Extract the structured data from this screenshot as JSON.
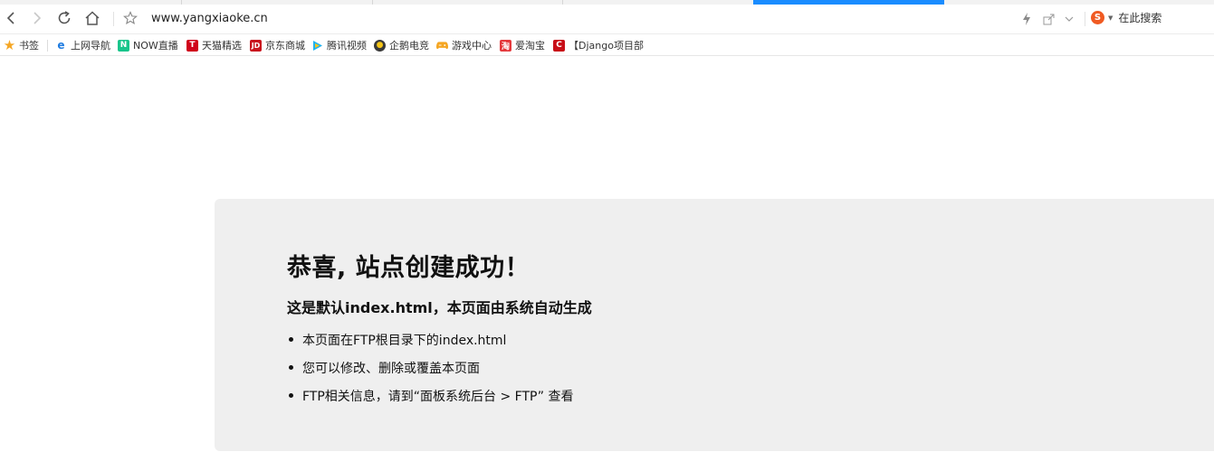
{
  "browser": {
    "url": "www.yangxiaoke.cn",
    "search_placeholder": "在此搜索"
  },
  "bookmarks": [
    {
      "label": "书签",
      "icon": "star-icon"
    },
    {
      "label": "上网导航",
      "icon": "ie-icon"
    },
    {
      "label": "NOW直播",
      "icon": "now-live-icon"
    },
    {
      "label": "天猫精选",
      "icon": "tmall-icon"
    },
    {
      "label": "京东商城",
      "icon": "jd-icon"
    },
    {
      "label": "腾讯视频",
      "icon": "tencent-video-icon"
    },
    {
      "label": "企鹅电竞",
      "icon": "penguin-esports-icon"
    },
    {
      "label": "游戏中心",
      "icon": "gamepad-icon"
    },
    {
      "label": "爱淘宝",
      "icon": "taobao-icon"
    },
    {
      "label": "【Django项目部",
      "icon": "django-c-icon"
    }
  ],
  "page": {
    "title": "恭喜, 站点创建成功！",
    "subtitle": "这是默认index.html，本页面由系统自动生成",
    "items": [
      "本页面在FTP根目录下的index.html",
      "您可以修改、删除或覆盖本页面",
      "FTP相关信息，请到“面板系统后台 > FTP” 查看"
    ]
  },
  "colors": {
    "active_tab": "#1a8cff",
    "card_background": "#efefef",
    "bookmark_star": "#f5a623"
  }
}
